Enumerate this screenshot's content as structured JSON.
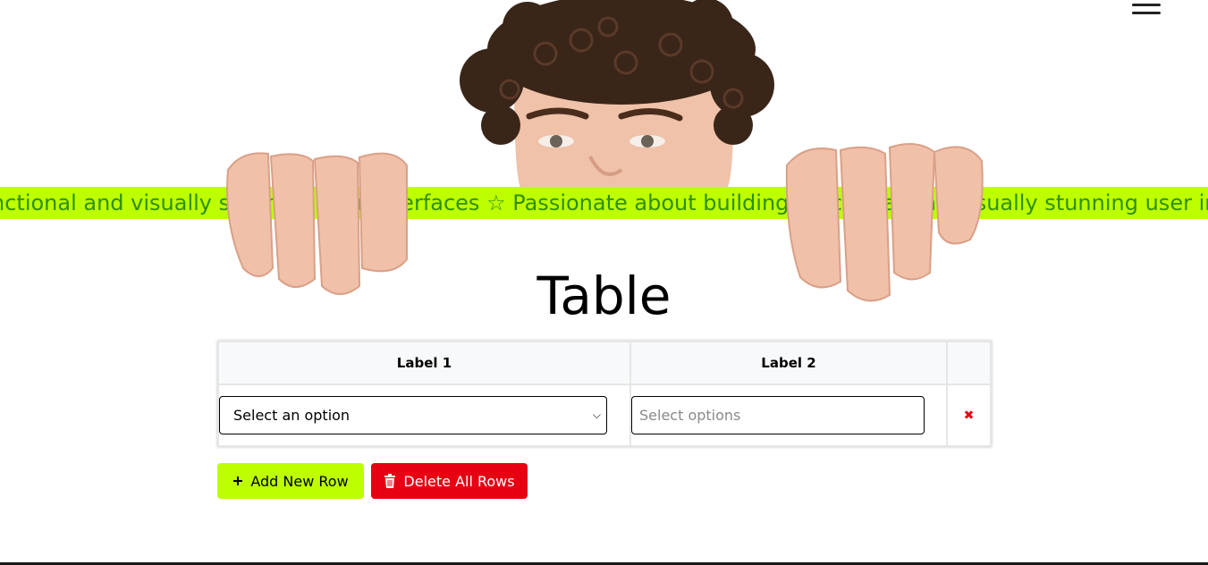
{
  "marquee": {
    "text": "nctional and visually stunning user interfaces ☆ Passionate about building functional and visually stunning user interfaces ☆ Passionate"
  },
  "page": {
    "title": "Table"
  },
  "table": {
    "headers": [
      "Label 1",
      "Label 2"
    ],
    "row": {
      "select_value": "Select an option",
      "input_placeholder": "Select options"
    }
  },
  "buttons": {
    "add_label": "Add New Row",
    "delete_label": "Delete All Rows"
  },
  "icons": {
    "menu": "hamburger-menu-icon",
    "remove": "close-icon",
    "add": "plus-icon",
    "delete": "trash-icon"
  },
  "colors": {
    "accent": "#bdff00",
    "marquee_text": "#2f8f00",
    "danger": "#e60012"
  }
}
